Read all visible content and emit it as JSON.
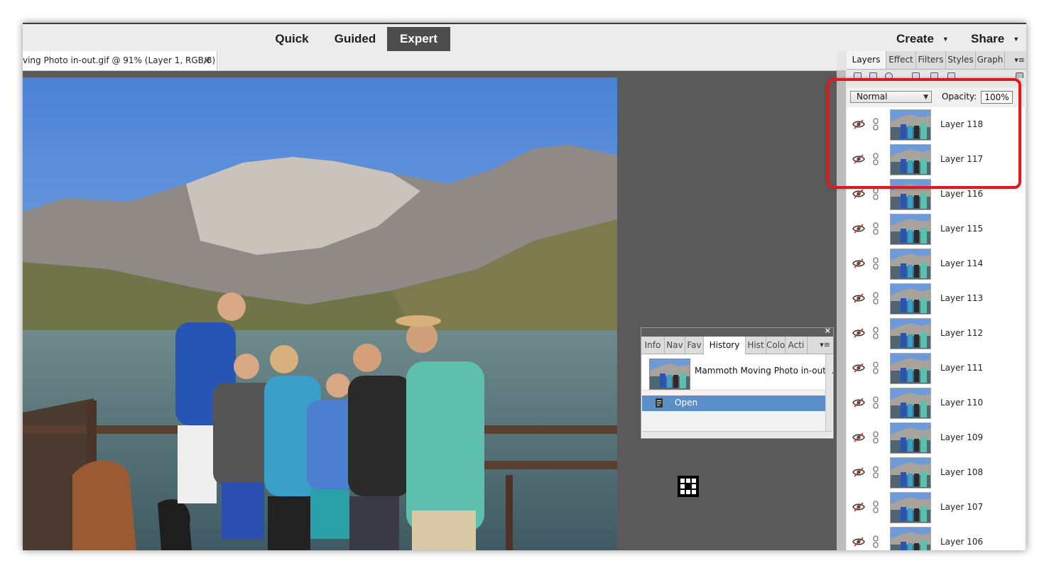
{
  "topbar": {
    "modes": [
      "Quick",
      "Guided",
      "Expert"
    ],
    "active_mode": "Expert",
    "create_label": "Create",
    "share_label": "Share"
  },
  "document_tab": {
    "title": "ving Photo in-out.gif @ 91% (Layer 1, RGB/8)",
    "close": "×"
  },
  "history_panel": {
    "close": "×",
    "tabs": [
      "Info",
      "Nav",
      "Fav",
      "History",
      "Hist",
      "Colo",
      "Acti"
    ],
    "active_tab": "History",
    "menu_icon": "▾≡",
    "snapshot_label": "Mammoth Moving Photo in-out...",
    "steps": [
      "Open"
    ]
  },
  "layers_panel": {
    "tabs": [
      "Layers",
      "Effect",
      "Filters",
      "Styles",
      "Graph"
    ],
    "active_tab": "Layers",
    "menu_icon": "▾≡",
    "blend_mode": "Normal",
    "opacity_label": "Opacity:",
    "opacity_value": "100%",
    "layers": [
      {
        "name": "Layer 118"
      },
      {
        "name": "Layer 117"
      },
      {
        "name": "Layer 116"
      },
      {
        "name": "Layer 115"
      },
      {
        "name": "Layer 114"
      },
      {
        "name": "Layer 113"
      },
      {
        "name": "Layer 112"
      },
      {
        "name": "Layer 111"
      },
      {
        "name": "Layer 110"
      },
      {
        "name": "Layer 109"
      },
      {
        "name": "Layer 108"
      },
      {
        "name": "Layer 107"
      },
      {
        "name": "Layer 106"
      }
    ]
  },
  "colors": {
    "highlight": "#e0191e",
    "canvas_bg": "#5a5a5a",
    "active_mode_bg": "#4d4d4d",
    "history_selected": "#5b8fc7"
  }
}
